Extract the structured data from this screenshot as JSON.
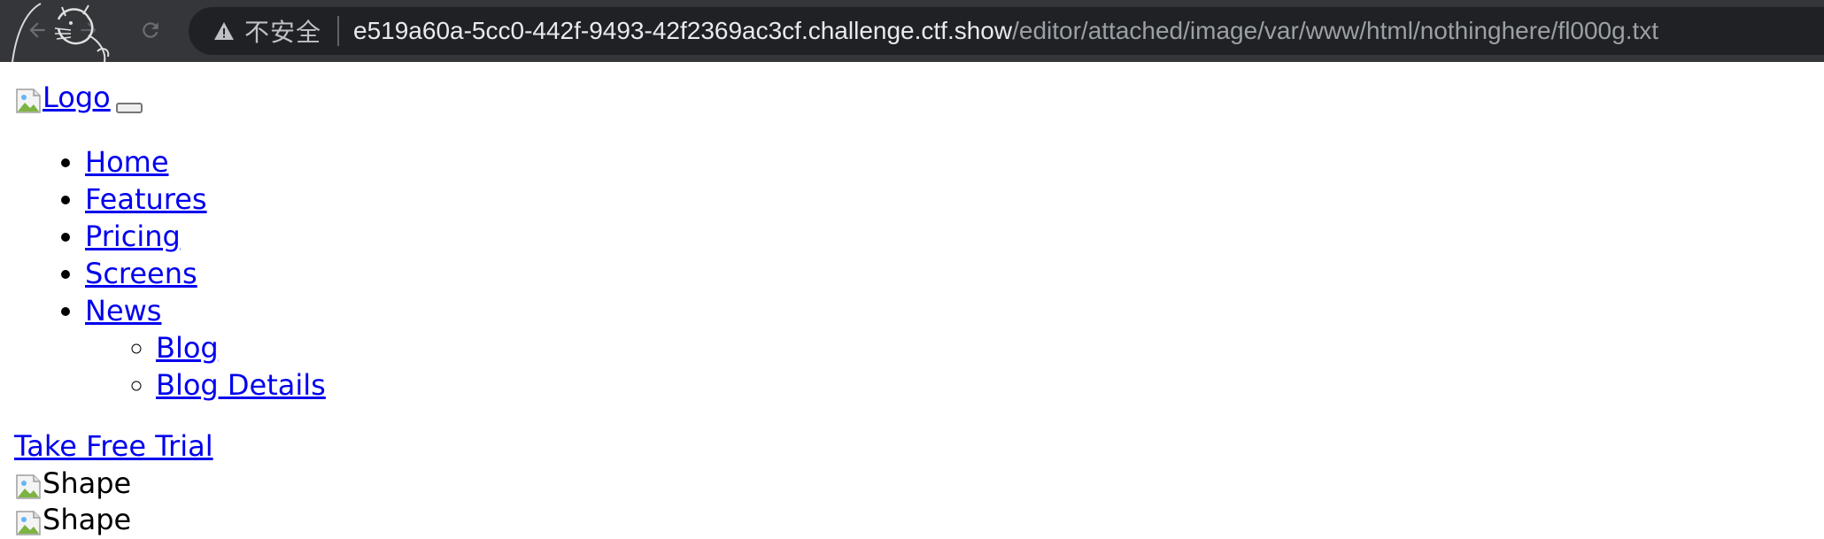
{
  "browser": {
    "security_label": "不安全",
    "url_host": "e519a60a-5cc0-442f-9493-42f2369ac3cf.challenge.ctf.show",
    "url_path": "/editor/attached/image/var/www/html/nothinghere/fl000g.txt",
    "icons": {
      "back": "back-arrow-icon",
      "forward": "forward-arrow-icon",
      "reload": "reload-icon",
      "security": "warning-triangle-icon"
    }
  },
  "page": {
    "logo_alt": "Logo",
    "nav": [
      {
        "label": "Home"
      },
      {
        "label": "Features"
      },
      {
        "label": "Pricing"
      },
      {
        "label": "Screens"
      },
      {
        "label": "News",
        "children": [
          {
            "label": "Blog"
          },
          {
            "label": "Blog Details"
          }
        ]
      }
    ],
    "cta_label": "Take Free Trial",
    "shape_alts": [
      "Shape",
      "Shape"
    ]
  },
  "colors": {
    "chrome_bg": "#35363a",
    "omnibox_bg": "#202124",
    "link": "#0000ee"
  }
}
